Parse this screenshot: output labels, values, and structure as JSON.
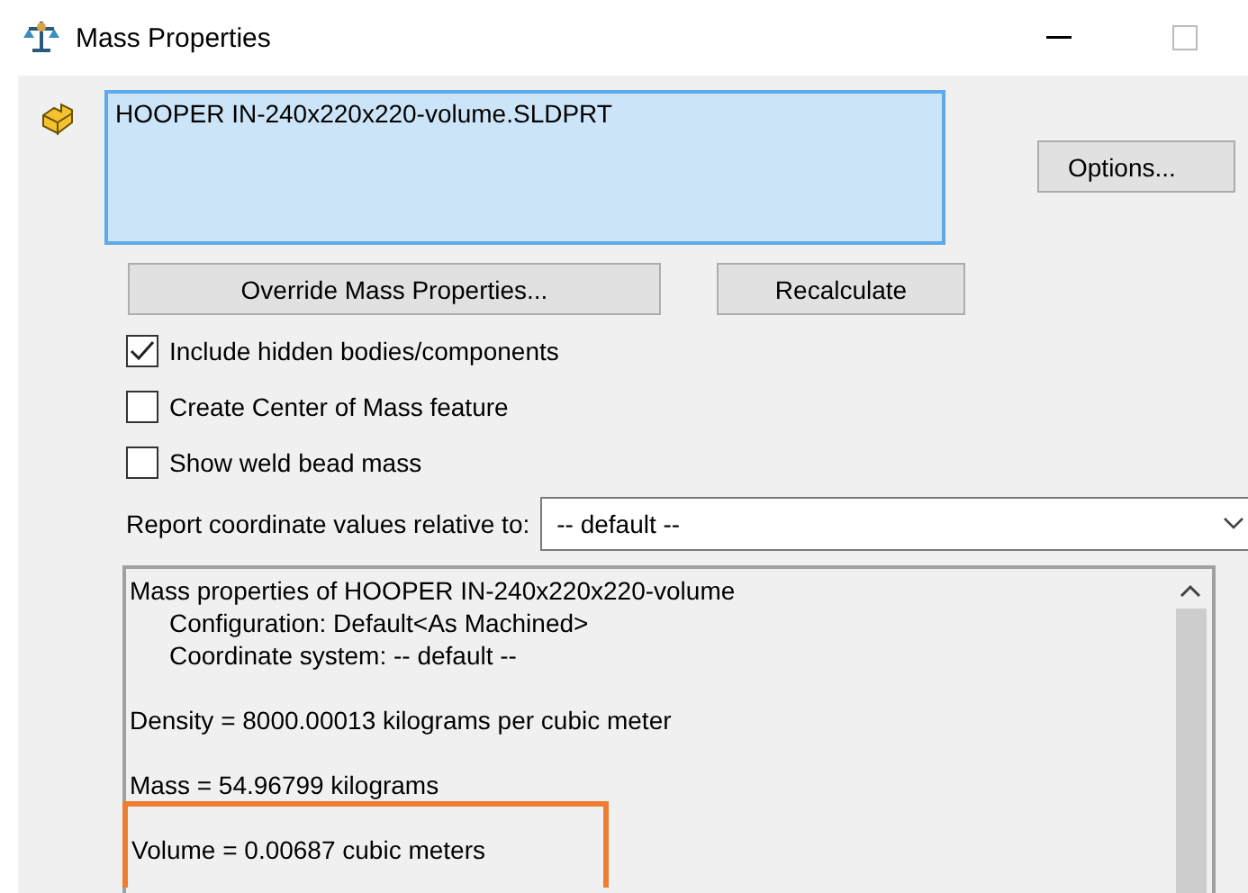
{
  "window": {
    "title": "Mass Properties"
  },
  "selection": {
    "items": [
      "HOOPER IN-240x220x220-volume.SLDPRT"
    ]
  },
  "options_button": "Options...",
  "buttons": [
    "Override Mass Properties...",
    "Recalculate"
  ],
  "checkboxes": [
    {
      "label": "Include hidden bodies/components",
      "checked": true
    },
    {
      "label": "Create Center of Mass feature",
      "checked": false
    },
    {
      "label": "Show weld bead mass",
      "checked": false
    }
  ],
  "report": {
    "label": "Report coordinate values relative to:",
    "value": "-- default --"
  },
  "results": [
    {
      "text": "Mass properties of HOOPER IN-240x220x220-volume",
      "kind": "heading",
      "highlighted": false
    },
    {
      "text": "Configuration: Default<As Machined>",
      "kind": "detail",
      "highlighted": false
    },
    {
      "text": "Coordinate system: -- default --",
      "kind": "detail",
      "highlighted": false
    },
    {
      "text": "Density = 8000.00013 kilograms per cubic meter",
      "kind": "value",
      "highlighted": false
    },
    {
      "text": "Mass = 54.96799 kilograms",
      "kind": "value",
      "highlighted": false
    },
    {
      "text": "Volume = 0.00687 cubic meters",
      "kind": "value",
      "highlighted": true
    }
  ]
}
